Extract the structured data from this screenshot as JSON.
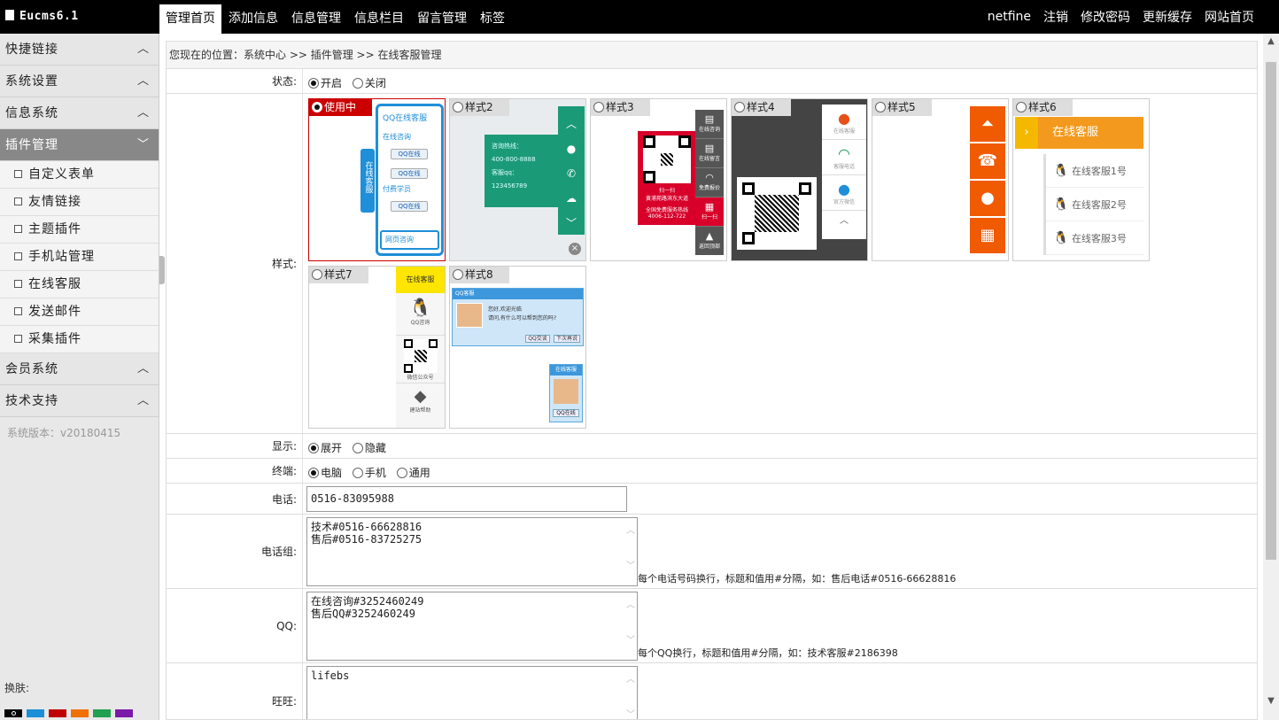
{
  "app": {
    "title": "Eucms6.1"
  },
  "topnav": [
    "管理首页",
    "添加信息",
    "信息管理",
    "信息栏目",
    "留言管理",
    "标签"
  ],
  "topright": {
    "user": "netfine",
    "logout": "注销",
    "password": "修改密码",
    "cache": "更新缓存",
    "home": "网站首页"
  },
  "sidebar": {
    "sections_top": [
      "快捷链接",
      "系统设置",
      "信息系统"
    ],
    "open_section": "插件管理",
    "plugin_items": [
      "自定义表单",
      "友情链接",
      "主题插件",
      "手机站管理",
      "在线客服",
      "发送邮件",
      "采集插件"
    ],
    "sections_bottom": [
      "会员系统",
      "技术支持"
    ],
    "version": "系统版本：v20180415",
    "skin_label": "换肤:",
    "skin_colors": [
      "#000000",
      "#1a8fd8",
      "#c00000",
      "#f07000",
      "#20a050",
      "#7a1aa8"
    ]
  },
  "breadcrumb": "您现在的位置：系统中心 >> 插件管理 >> 在线客服管理",
  "form": {
    "status": {
      "label": "状态:",
      "options": [
        "开启",
        "关闭"
      ],
      "selected": 0
    },
    "style": {
      "label": "样式:",
      "options": [
        "使用中",
        "样式2",
        "样式3",
        "样式4",
        "样式5",
        "样式6",
        "样式7",
        "样式8"
      ],
      "selected": 0
    },
    "display": {
      "label": "显示:",
      "options": [
        "展开",
        "隐藏"
      ],
      "selected": 0
    },
    "terminal": {
      "label": "终端:",
      "options": [
        "电脑",
        "手机",
        "通用"
      ],
      "selected": 0
    },
    "phone": {
      "label": "电话:",
      "value": "0516-83095988"
    },
    "phone_group": {
      "label": "电话组:",
      "value": "技术#0516-66628816\n售后#0516-83725275",
      "hint": "每个电话号码换行，标题和值用#分隔，如：售后电话#0516-66628816"
    },
    "qq": {
      "label": "QQ:",
      "value": "在线咨询#3252460249\n售后QQ#3252460249",
      "hint": "每个QQ换行，标题和值用#分隔，如：技术客服#2186398"
    },
    "wangwang": {
      "label": "旺旺:",
      "value": "lifebs"
    }
  },
  "previews": {
    "s1": {
      "title": "QQ在线客服",
      "items": [
        "在线咨询",
        "QQ在线",
        "QQ在线",
        "付费学员",
        "QQ在线"
      ],
      "tab": "在线客服",
      "footer": "网页咨询"
    },
    "s2": {
      "lines": [
        "咨询热线：",
        "400-800-8888",
        "客服qq：",
        "123456789"
      ]
    },
    "s3": {
      "icons": [
        "在线咨询",
        "在线留言",
        "免费报价",
        "扫一扫",
        "返回顶部"
      ],
      "caption": "扫一扫",
      "sub": "黄浦苑路滨东大道",
      "hotline_label": "全国免费服务热线",
      "hotline": "4006-112-722"
    },
    "s4": {
      "icons": [
        "在线客服",
        "客服电话",
        "官方微信"
      ]
    },
    "s6": {
      "title": "在线客服",
      "items": [
        "在线客服1号",
        "在线客服2号",
        "在线客服3号"
      ]
    },
    "s7": {
      "title": "在线客服",
      "items": [
        "QQ咨询",
        "微信公众号",
        "建站帮助"
      ]
    },
    "s8": {
      "title": "QQ客服",
      "greet": "您好,欢迎光临",
      "ask": "请问,有什么可以帮到您的吗?",
      "b1": "QQ交谈",
      "b2": "下次再说",
      "mini_title": "在线客服",
      "mini_btn": "QQ在线"
    }
  }
}
